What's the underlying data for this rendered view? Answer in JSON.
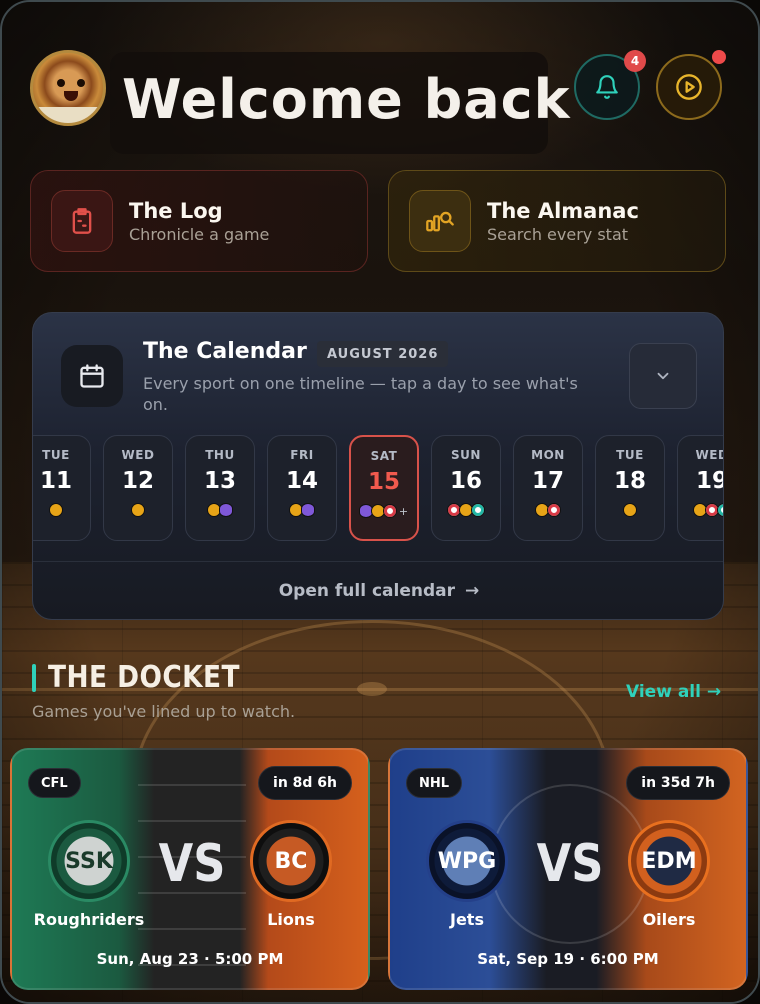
{
  "header": {
    "title": "Welcome back",
    "notification_count": "4",
    "icons": [
      "bell-icon",
      "play-icon"
    ],
    "accent_colors": {
      "bell": "#1f6a63",
      "play": "#8c6a1c",
      "badge": "#e04a4a"
    }
  },
  "quick_actions": [
    {
      "title": "The Log",
      "subtitle": "Chronicle a game",
      "icon": "clipboard-icon",
      "color": "#e0504a"
    },
    {
      "title": "The Almanac",
      "subtitle": "Search every stat",
      "icon": "stats-search-icon",
      "color": "#e2a424"
    }
  ],
  "calendar": {
    "title": "The Calendar",
    "month": "AUGUST 2026",
    "subtitle": "Every sport on one timeline — tap a day to see what's on.",
    "footer_link": "Open full calendar",
    "footer_arrow": "→",
    "selected_day": "15",
    "days": [
      {
        "dow": "TUE",
        "num": "11",
        "dots": [
          "base"
        ]
      },
      {
        "dow": "WED",
        "num": "12",
        "dots": [
          "base"
        ]
      },
      {
        "dow": "THU",
        "num": "13",
        "dots": [
          "base",
          "ball"
        ]
      },
      {
        "dow": "FRI",
        "num": "14",
        "dots": [
          "base",
          "ball"
        ]
      },
      {
        "dow": "SAT",
        "num": "15",
        "dots": [
          "ball",
          "base",
          "red"
        ],
        "more": "+"
      },
      {
        "dow": "SUN",
        "num": "16",
        "dots": [
          "red",
          "base",
          "teal"
        ]
      },
      {
        "dow": "MON",
        "num": "17",
        "dots": [
          "base",
          "red"
        ]
      },
      {
        "dow": "TUE",
        "num": "18",
        "dots": [
          "base"
        ]
      },
      {
        "dow": "WED",
        "num": "19",
        "dots": [
          "base",
          "red",
          "teal"
        ]
      }
    ]
  },
  "docket": {
    "title": "THE DOCKET",
    "subtitle": "Games you've lined up to watch.",
    "view_all": "View all →",
    "games": [
      {
        "league": "CFL",
        "countdown": "in 8d 6h",
        "vs": "VS",
        "home": {
          "abbr": "SSK",
          "name": "Roughriders",
          "color": "#1e7a55"
        },
        "away": {
          "abbr": "BC",
          "name": "Lions",
          "color": "#d5601c"
        },
        "time": "Sun, Aug 23 · 5:00 PM"
      },
      {
        "league": "NHL",
        "countdown": "in 35d 7h",
        "vs": "VS",
        "home": {
          "abbr": "WPG",
          "name": "Jets",
          "color": "#1f3f8a"
        },
        "away": {
          "abbr": "EDM",
          "name": "Oilers",
          "color": "#d26420"
        },
        "time": "Sat, Sep 19 · 6:00 PM"
      }
    ]
  }
}
